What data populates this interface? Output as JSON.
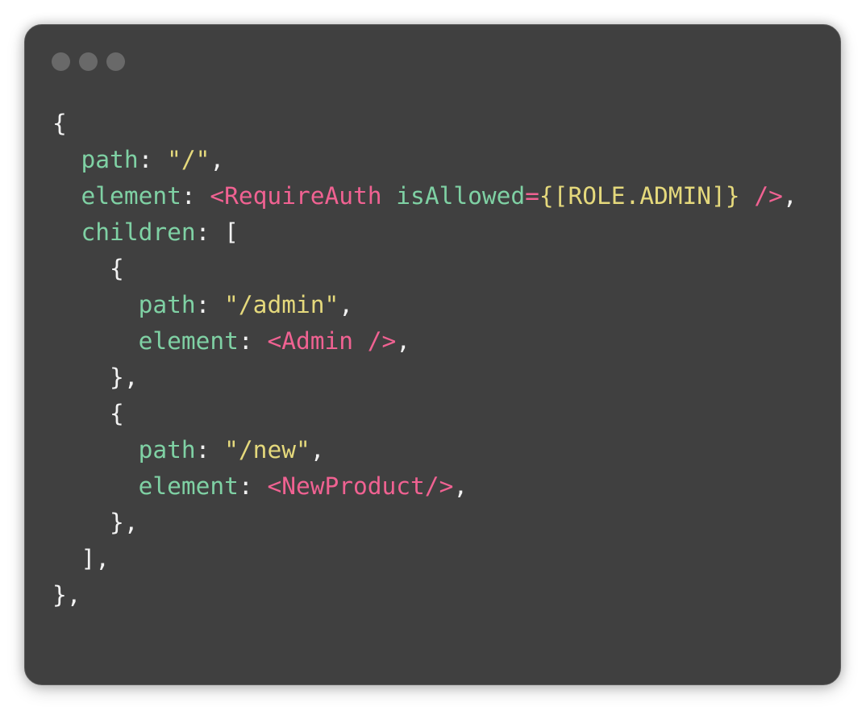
{
  "window": {
    "dots": [
      "close",
      "minimize",
      "maximize"
    ],
    "colors": {
      "background": "#404040",
      "dot": "#696969",
      "plain": "#f2f2f2",
      "key": "#7fd1a4",
      "string": "#e5d97c",
      "tag": "#f06292"
    }
  },
  "code": {
    "lines": [
      [
        {
          "t": "{",
          "k": "plain"
        }
      ],
      [
        {
          "t": "  ",
          "k": "plain"
        },
        {
          "t": "path",
          "k": "key"
        },
        {
          "t": ": ",
          "k": "plain"
        },
        {
          "t": "\"/\"",
          "k": "str"
        },
        {
          "t": ",",
          "k": "plain"
        }
      ],
      [
        {
          "t": "  ",
          "k": "plain"
        },
        {
          "t": "element",
          "k": "key"
        },
        {
          "t": ": ",
          "k": "plain"
        },
        {
          "t": "<RequireAuth",
          "k": "tag"
        },
        {
          "t": " ",
          "k": "plain"
        },
        {
          "t": "isAllowed",
          "k": "attr"
        },
        {
          "t": "=",
          "k": "tag"
        },
        {
          "t": "{[ROLE.ADMIN]}",
          "k": "expr"
        },
        {
          "t": " ",
          "k": "plain"
        },
        {
          "t": "/>",
          "k": "tag"
        },
        {
          "t": ",",
          "k": "plain"
        }
      ],
      [
        {
          "t": "  ",
          "k": "plain"
        },
        {
          "t": "children",
          "k": "key"
        },
        {
          "t": ": [",
          "k": "plain"
        }
      ],
      [
        {
          "t": "    {",
          "k": "plain"
        }
      ],
      [
        {
          "t": "      ",
          "k": "plain"
        },
        {
          "t": "path",
          "k": "key"
        },
        {
          "t": ": ",
          "k": "plain"
        },
        {
          "t": "\"/admin\"",
          "k": "str"
        },
        {
          "t": ",",
          "k": "plain"
        }
      ],
      [
        {
          "t": "      ",
          "k": "plain"
        },
        {
          "t": "element",
          "k": "key"
        },
        {
          "t": ": ",
          "k": "plain"
        },
        {
          "t": "<Admin />",
          "k": "tag"
        },
        {
          "t": ",",
          "k": "plain"
        }
      ],
      [
        {
          "t": "    },",
          "k": "plain"
        }
      ],
      [
        {
          "t": "    {",
          "k": "plain"
        }
      ],
      [
        {
          "t": "      ",
          "k": "plain"
        },
        {
          "t": "path",
          "k": "key"
        },
        {
          "t": ": ",
          "k": "plain"
        },
        {
          "t": "\"/new\"",
          "k": "str"
        },
        {
          "t": ",",
          "k": "plain"
        }
      ],
      [
        {
          "t": "      ",
          "k": "plain"
        },
        {
          "t": "element",
          "k": "key"
        },
        {
          "t": ": ",
          "k": "plain"
        },
        {
          "t": "<NewProduct/>",
          "k": "tag"
        },
        {
          "t": ",",
          "k": "plain"
        }
      ],
      [
        {
          "t": "    },",
          "k": "plain"
        }
      ],
      [
        {
          "t": "  ],",
          "k": "plain"
        }
      ],
      [
        {
          "t": "},",
          "k": "plain"
        }
      ]
    ]
  }
}
